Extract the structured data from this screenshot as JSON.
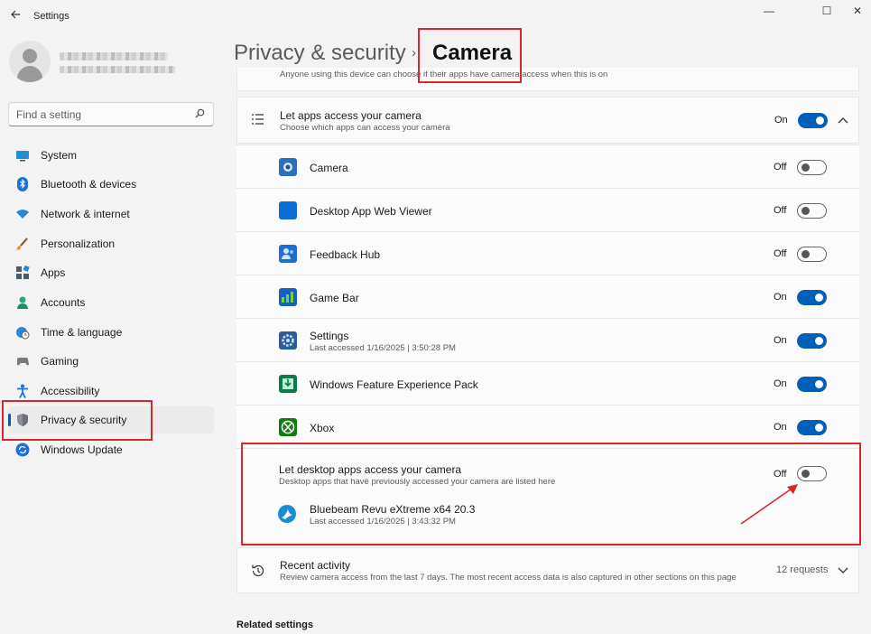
{
  "window": {
    "title": "Settings",
    "back_icon": "back-arrow-icon",
    "minimize": "—",
    "maximize": "☐",
    "close": "✕"
  },
  "search": {
    "placeholder": "Find a setting"
  },
  "sidebar": {
    "items": [
      {
        "label": "System",
        "icon": "monitor-icon"
      },
      {
        "label": "Bluetooth & devices",
        "icon": "bluetooth-icon"
      },
      {
        "label": "Network & internet",
        "icon": "wifi-icon"
      },
      {
        "label": "Personalization",
        "icon": "brush-icon"
      },
      {
        "label": "Apps",
        "icon": "apps-icon"
      },
      {
        "label": "Accounts",
        "icon": "person-icon"
      },
      {
        "label": "Time & language",
        "icon": "globe-clock-icon"
      },
      {
        "label": "Gaming",
        "icon": "gamepad-icon"
      },
      {
        "label": "Accessibility",
        "icon": "accessibility-icon"
      },
      {
        "label": "Privacy & security",
        "icon": "shield-icon",
        "selected": true
      },
      {
        "label": "Windows Update",
        "icon": "update-icon"
      }
    ]
  },
  "header": {
    "parent": "Privacy & security",
    "separator": "›",
    "current": "Camera"
  },
  "top_partial_text": "Anyone using this device can choose if their apps have camera access when this is on",
  "master": {
    "label": "Let apps access your camera",
    "sub": "Choose which apps can access your camera",
    "state": "On"
  },
  "apps": [
    {
      "label": "Camera",
      "sub": "",
      "state": "Off",
      "icon": "camera-app-icon"
    },
    {
      "label": "Desktop App Web Viewer",
      "sub": "",
      "state": "Off",
      "icon": "blue-square-icon"
    },
    {
      "label": "Feedback Hub",
      "sub": "",
      "state": "Off",
      "icon": "feedback-hub-icon"
    },
    {
      "label": "Game Bar",
      "sub": "",
      "state": "On",
      "icon": "game-bar-icon"
    },
    {
      "label": "Settings",
      "sub": "Last accessed 1/16/2025  |  3:50:28 PM",
      "state": "On",
      "icon": "settings-gear-icon"
    },
    {
      "label": "Windows Feature Experience Pack",
      "sub": "",
      "state": "On",
      "icon": "feature-pack-icon"
    },
    {
      "label": "Xbox",
      "sub": "",
      "state": "On",
      "icon": "xbox-icon"
    }
  ],
  "desktop": {
    "label": "Let desktop apps access your camera",
    "sub": "Desktop apps that have previously accessed your camera are listed here",
    "state": "Off",
    "app_label": "Bluebeam Revu eXtreme x64 20.3",
    "app_sub": "Last accessed 1/16/2025  |  3:43:32 PM"
  },
  "recent": {
    "label": "Recent activity",
    "sub": "Review camera access from the last 7 days. The most recent access data is also captured in other sections on this page",
    "count": "12 requests"
  },
  "related": {
    "label": "Related settings"
  },
  "colors": {
    "accent": "#005fb8",
    "callout": "#d7262e"
  }
}
